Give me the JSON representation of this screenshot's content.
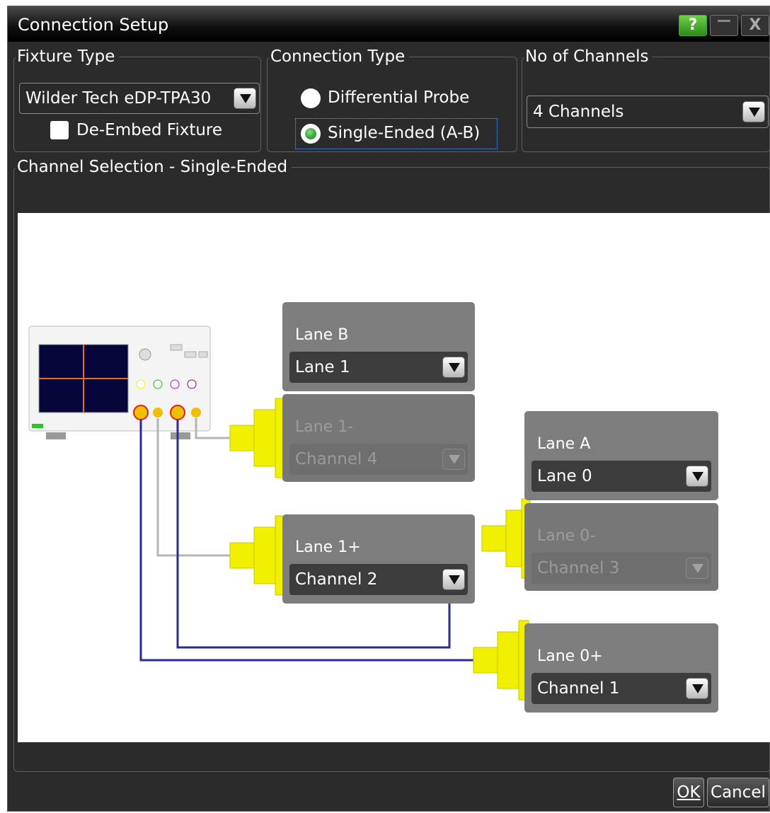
{
  "window": {
    "title": "Connection Setup",
    "help_label": "?",
    "min_label": "",
    "close_label": "X"
  },
  "fixture": {
    "legend": "Fixture Type",
    "selected": "Wilder Tech eDP-TPA30",
    "deembed_label": "De-Embed Fixture",
    "deembed_checked": false
  },
  "connection": {
    "legend": "Connection Type",
    "options": [
      "Differential Probe",
      "Single-Ended (A-B)"
    ],
    "selected": "Single-Ended (A-B)"
  },
  "channels": {
    "legend": "No of Channels",
    "selected": "4 Channels"
  },
  "selection": {
    "legend": "Channel Selection - Single-Ended",
    "lanes": [
      {
        "name": "Lane B",
        "value": "Lane 1",
        "enabled": true
      },
      {
        "name": "Lane 1-",
        "value": "Channel 4",
        "enabled": false
      },
      {
        "name": "Lane 1+",
        "value": "Channel 2",
        "enabled": true
      },
      {
        "name": "Lane A",
        "value": "Lane 0",
        "enabled": true
      },
      {
        "name": "Lane 0-",
        "value": "Channel 3",
        "enabled": false
      },
      {
        "name": "Lane 0+",
        "value": "Channel 1",
        "enabled": true
      }
    ]
  },
  "colors": {
    "cable_blue": "#2a2a9a",
    "cable_gray": "#b5b5b5",
    "connector_yellow": "#f0f000",
    "probe_red": "#e02020"
  },
  "buttons": {
    "ok": "OK",
    "cancel": "Cancel"
  }
}
